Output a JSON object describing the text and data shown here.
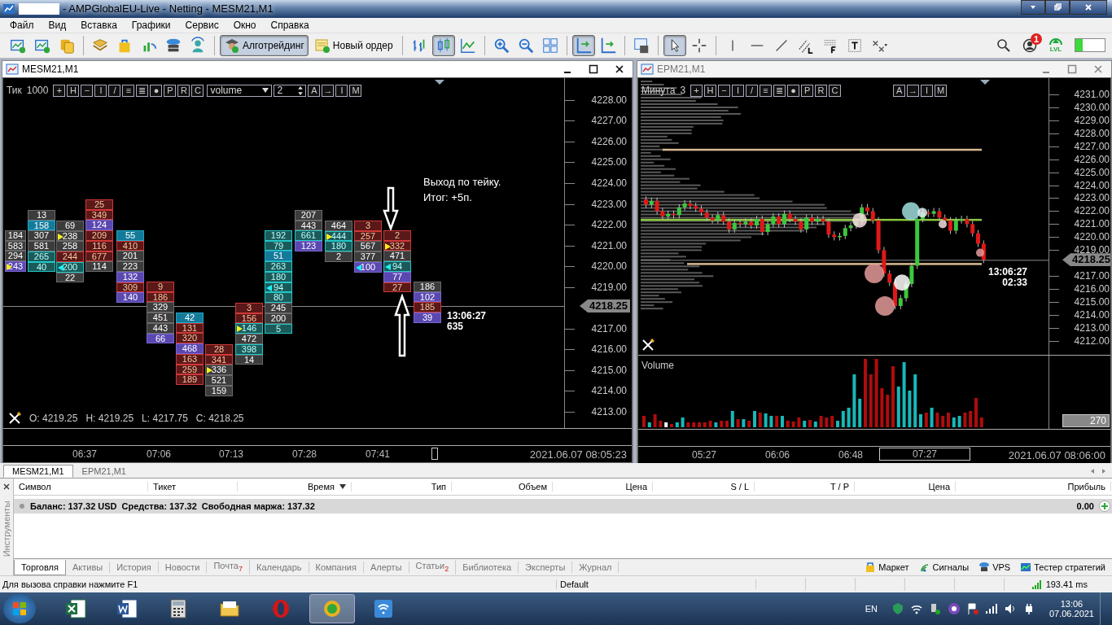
{
  "window": {
    "title": "- AMPGlobalEU-Live - Netting - MESM21,M1"
  },
  "menu": [
    "Файл",
    "Вид",
    "Вставка",
    "Графики",
    "Сервис",
    "Окно",
    "Справка"
  ],
  "toolbar": {
    "tools_left": [
      {
        "kind": "newchart",
        "pressed": false
      },
      {
        "kind": "profiles",
        "pressed": false
      },
      {
        "kind": "coins",
        "pressed": false
      },
      {
        "kind": "sep"
      },
      {
        "kind": "book",
        "pressed": false
      },
      {
        "kind": "bag",
        "pressed": false
      },
      {
        "kind": "signal",
        "pressed": false
      },
      {
        "kind": "server",
        "pressed": false
      },
      {
        "kind": "person",
        "pressed": false
      },
      {
        "kind": "sep"
      }
    ],
    "buttons": [
      {
        "label": "Алготрейдинг",
        "kind": "algo",
        "pressed": true
      },
      {
        "label": "Новый ордер",
        "kind": "order",
        "pressed": false
      }
    ],
    "tools_right": [
      {
        "kind": "sep"
      },
      {
        "kind": "bars",
        "pressed": false
      },
      {
        "kind": "candles",
        "pressed": true
      },
      {
        "kind": "line",
        "pressed": false
      },
      {
        "kind": "sep"
      },
      {
        "kind": "zoomin",
        "pressed": false
      },
      {
        "kind": "zoomout",
        "pressed": false
      },
      {
        "kind": "tile",
        "pressed": false
      },
      {
        "kind": "sep"
      },
      {
        "kind": "scroll",
        "pressed": true
      },
      {
        "kind": "shift",
        "pressed": false
      },
      {
        "kind": "sep"
      },
      {
        "kind": "template",
        "pressed": false
      },
      {
        "kind": "sep"
      },
      {
        "kind": "cursor",
        "pressed": true
      },
      {
        "kind": "crosshair",
        "pressed": false
      },
      {
        "kind": "sep"
      },
      {
        "kind": "vline",
        "pressed": false
      },
      {
        "kind": "hline",
        "pressed": false
      },
      {
        "kind": "trend",
        "pressed": false
      },
      {
        "kind": "channel",
        "pressed": false
      },
      {
        "kind": "fibo",
        "pressed": false
      },
      {
        "kind": "text",
        "pressed": false
      },
      {
        "kind": "arrows",
        "pressed": false
      }
    ],
    "notifications": "1",
    "level_badge": "LVL"
  },
  "footprint_chart": {
    "title": "MESM21,M1",
    "period": "Тик",
    "period_value": "1000",
    "tools": [
      "+",
      "H",
      "−",
      "I",
      "/",
      "≡",
      "≣",
      "●",
      "P",
      "R",
      "C"
    ],
    "select": "volume",
    "spinner": "2",
    "tools2": [
      "A",
      "→",
      "I",
      "M"
    ],
    "prices": [
      "4228.00",
      "4227.00",
      "4226.00",
      "4225.00",
      "4224.00",
      "4223.00",
      "4222.00",
      "4221.00",
      "4220.00",
      "4219.00",
      "4217.00",
      "4216.00",
      "4215.00",
      "4214.00",
      "4213.00"
    ],
    "current_price": "4218.25",
    "columns": [
      {
        "cells": [
          {
            "t": "184",
            "kind": "n"
          },
          {
            "t": "583",
            "kind": "n"
          },
          {
            "t": "294",
            "kind": "n"
          },
          {
            "t": "243",
            "kind": "purple",
            "marker": {
              "kind": "buy"
            }
          }
        ]
      },
      {
        "cells": [
          {
            "t": "13",
            "kind": "n"
          },
          {
            "t": "158",
            "kind": "blue"
          },
          {
            "t": "307",
            "kind": "n"
          },
          {
            "t": "581",
            "kind": "n"
          },
          {
            "t": "265",
            "kind": "teal"
          },
          {
            "t": "40",
            "kind": "teal"
          }
        ]
      },
      {
        "cells": [
          {
            "t": "69",
            "kind": "n"
          },
          {
            "t": "238",
            "kind": "n",
            "marker": {
              "kind": "buy"
            }
          },
          {
            "t": "258",
            "kind": "n"
          },
          {
            "t": "244",
            "kind": "red"
          },
          {
            "t": "200",
            "kind": "teal",
            "marker": {
              "kind": "sell"
            }
          },
          {
            "t": "22",
            "kind": "n"
          }
        ]
      },
      {
        "cells": [
          {
            "t": "25",
            "kind": "red"
          },
          {
            "t": "349",
            "kind": "red"
          },
          {
            "t": "124",
            "kind": "purple"
          },
          {
            "t": "209",
            "kind": "red"
          },
          {
            "t": "116",
            "kind": "red"
          },
          {
            "t": "677",
            "kind": "red"
          },
          {
            "t": "114",
            "kind": "n"
          }
        ]
      },
      {
        "cells": [
          {
            "t": "55",
            "kind": "blue"
          },
          {
            "t": "410",
            "kind": "red"
          },
          {
            "t": "201",
            "kind": "n"
          },
          {
            "t": "223",
            "kind": "n"
          },
          {
            "t": "132",
            "kind": "purple"
          },
          {
            "t": "309",
            "kind": "red"
          },
          {
            "t": "140",
            "kind": "purple"
          }
        ]
      },
      {
        "cells": [
          {
            "t": "9",
            "kind": "red"
          },
          {
            "t": "186",
            "kind": "red"
          },
          {
            "t": "329",
            "kind": "n"
          },
          {
            "t": "451",
            "kind": "n"
          },
          {
            "t": "443",
            "kind": "n"
          },
          {
            "t": "66",
            "kind": "purple"
          }
        ]
      },
      {
        "cells": [
          {
            "t": "42",
            "kind": "blue"
          },
          {
            "t": "131",
            "kind": "red"
          },
          {
            "t": "320",
            "kind": "red"
          },
          {
            "t": "468",
            "kind": "purple"
          },
          {
            "t": "163",
            "kind": "red"
          },
          {
            "t": "259",
            "kind": "red"
          },
          {
            "t": "189",
            "kind": "red"
          }
        ]
      },
      {
        "cells": [
          {
            "t": "28",
            "kind": "red"
          },
          {
            "t": "341",
            "kind": "red"
          },
          {
            "t": "336",
            "kind": "n",
            "marker": {
              "kind": "buy"
            }
          },
          {
            "t": "521",
            "kind": "n"
          },
          {
            "t": "159",
            "kind": "n"
          }
        ]
      },
      {
        "cells": [
          {
            "t": "3",
            "kind": "red"
          },
          {
            "t": "156",
            "kind": "red"
          },
          {
            "t": "146",
            "kind": "teal",
            "marker": {
              "kind": "buy"
            }
          },
          {
            "t": "472",
            "kind": "n"
          },
          {
            "t": "398",
            "kind": "teal"
          },
          {
            "t": "14",
            "kind": "n"
          }
        ]
      },
      {
        "cells": [
          {
            "t": "192",
            "kind": "teal"
          },
          {
            "t": "79",
            "kind": "teal"
          },
          {
            "t": "51",
            "kind": "blue"
          },
          {
            "t": "263",
            "kind": "teal"
          },
          {
            "t": "180",
            "kind": "teal"
          },
          {
            "t": "94",
            "kind": "teal",
            "marker": {
              "kind": "sell"
            }
          },
          {
            "t": "80",
            "kind": "teal"
          },
          {
            "t": "245",
            "kind": "n"
          },
          {
            "t": "200",
            "kind": "n"
          },
          {
            "t": "5",
            "kind": "teal"
          }
        ]
      },
      {
        "cells": [
          {
            "t": "207",
            "kind": "n"
          },
          {
            "t": "443",
            "kind": "n"
          },
          {
            "t": "661",
            "kind": "teal"
          },
          {
            "t": "123",
            "kind": "purple"
          }
        ]
      },
      {
        "cells": [
          {
            "t": "464",
            "kind": "n"
          },
          {
            "t": "444",
            "kind": "teal",
            "marker": {
              "kind": "buy"
            }
          },
          {
            "t": "180",
            "kind": "teal"
          },
          {
            "t": "2",
            "kind": "n"
          }
        ]
      },
      {
        "cells": [
          {
            "t": "3",
            "kind": "red"
          },
          {
            "t": "257",
            "kind": "red"
          },
          {
            "t": "567",
            "kind": "n"
          },
          {
            "t": "377",
            "kind": "n"
          },
          {
            "t": "100",
            "kind": "purple",
            "marker": {
              "kind": "sell"
            }
          }
        ]
      },
      {
        "cells": [
          {
            "t": "2",
            "kind": "red"
          },
          {
            "t": "332",
            "kind": "red",
            "marker": {
              "kind": "buy"
            }
          },
          {
            "t": "471",
            "kind": "n"
          },
          {
            "t": "94",
            "kind": "teal",
            "marker": {
              "kind": "sell"
            }
          },
          {
            "t": "77",
            "kind": "purple"
          },
          {
            "t": "27",
            "kind": "red"
          }
        ]
      },
      {
        "cells": [
          {
            "t": "186",
            "kind": "n"
          },
          {
            "t": "102",
            "kind": "purple"
          },
          {
            "t": "185",
            "kind": "red"
          },
          {
            "t": "39",
            "kind": "purple"
          }
        ]
      }
    ],
    "annotation": [
      "Выход по тейку.",
      "Итог: +5п."
    ],
    "last_time": "13:06:27",
    "last_volume": "635",
    "ohlc": [
      "O: 4219.25",
      "H: 4219.25",
      "L: 4217.75",
      "C: 4218.25"
    ],
    "times": [
      "06:37",
      "07:06",
      "07:13",
      "07:28",
      "07:41"
    ],
    "datetime": "2021.06.07 08:05:23"
  },
  "candle_chart": {
    "title": "EPM21,M1",
    "period": "Минута",
    "period_value": "3",
    "tools": [
      "+",
      "H",
      "−",
      "I",
      "/",
      "≡",
      "≣",
      "●",
      "P",
      "R",
      "C"
    ],
    "tools2": [
      "A",
      "→",
      "I",
      "M"
    ],
    "prices": [
      "4231.00",
      "4230.00",
      "4229.00",
      "4228.00",
      "4227.00",
      "4226.00",
      "4225.00",
      "4224.00",
      "4223.00",
      "4222.00",
      "4221.00",
      "4220.00",
      "4219.00",
      "4217.00",
      "4216.00",
      "4215.00",
      "4214.00",
      "4213.00",
      "4212.00"
    ],
    "current_price": "4218.25",
    "last_time": "13:06:27",
    "countdown": "02:33",
    "volume_label": "Volume",
    "volume_scale": "270",
    "times": [
      {
        "label": "05:27",
        "boxed": false
      },
      {
        "label": "06:06",
        "boxed": false
      },
      {
        "label": "06:48",
        "boxed": false
      },
      {
        "label": "07:27",
        "boxed": true
      }
    ],
    "datetime": "2021.06.07 08:06:00"
  },
  "terminal": {
    "chart_tabs": [
      {
        "label": "MESM21,M1",
        "selected": true
      },
      {
        "label": "EPM21,M1",
        "selected": false
      }
    ],
    "side_label": "Инструменты",
    "columns": [
      {
        "label": "Символ",
        "sorted": false
      },
      {
        "label": "Тикет",
        "sorted": false
      },
      {
        "label": "Время",
        "sorted": true
      },
      {
        "label": "Тип",
        "sorted": false
      },
      {
        "label": "Объем",
        "sorted": false
      },
      {
        "label": "Цена",
        "sorted": false
      },
      {
        "label": "S / L",
        "sorted": false
      },
      {
        "label": "T / P",
        "sorted": false
      },
      {
        "label": "Цена",
        "sorted": false
      },
      {
        "label": "Прибыль",
        "sorted": false
      }
    ],
    "balance": [
      "Баланс: 137.32 USD",
      "Средства: 137.32",
      "Свободная маржа: 137.32"
    ],
    "profit": "0.00",
    "tabs": [
      {
        "label": "Торговля",
        "selected": true
      },
      {
        "label": "Активы",
        "selected": false
      },
      {
        "label": "История",
        "selected": false
      },
      {
        "label": "Новости",
        "selected": false
      },
      {
        "label": "Почта",
        "selected": false,
        "count": "7"
      },
      {
        "label": "Календарь",
        "selected": false
      },
      {
        "label": "Компания",
        "selected": false
      },
      {
        "label": "Алерты",
        "selected": false
      },
      {
        "label": "Статьи",
        "selected": false,
        "count": "2"
      },
      {
        "label": "Библиотека",
        "selected": false
      },
      {
        "label": "Эксперты",
        "selected": false
      },
      {
        "label": "Журнал",
        "selected": false
      }
    ],
    "services": [
      {
        "label": "Маркет",
        "kind": "market"
      },
      {
        "label": "Сигналы",
        "kind": "signals"
      },
      {
        "label": "VPS",
        "kind": "vps"
      },
      {
        "label": "Тестер стратегий",
        "kind": "tester"
      }
    ]
  },
  "status_bar": {
    "help": "Для вызова справки нажмите F1",
    "profile": "Default",
    "ping": "193.41 ms"
  },
  "taskbar": {
    "apps": [
      {
        "kind": "excel",
        "active": false
      },
      {
        "kind": "word",
        "active": false
      },
      {
        "kind": "calculator",
        "active": false
      },
      {
        "kind": "folder",
        "active": false
      },
      {
        "kind": "opera",
        "active": false
      },
      {
        "kind": "terminal",
        "active": true
      },
      {
        "kind": "wifi",
        "active": false
      }
    ],
    "language": "EN",
    "time": "13:06",
    "date": "07.06.2021"
  }
}
